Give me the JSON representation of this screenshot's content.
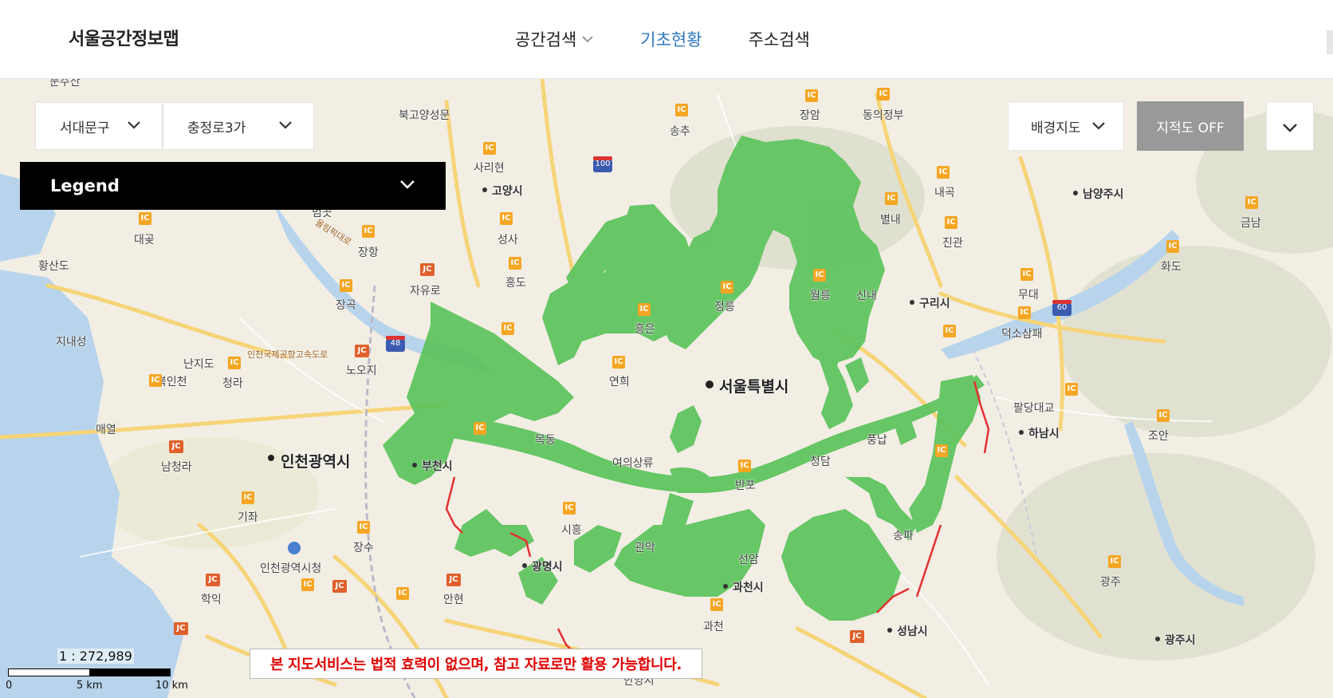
{
  "header": {
    "brand": "서울공간정보맵",
    "nav": [
      {
        "label": "공간검색",
        "has_dropdown": true,
        "active": false
      },
      {
        "label": "기초현황",
        "has_dropdown": false,
        "active": true
      },
      {
        "label": "주소검색",
        "has_dropdown": false,
        "active": false
      }
    ]
  },
  "controls": {
    "district_select": "서대문구",
    "dong_select": "충정로3가",
    "legend_label": "Legend",
    "basemap_select": "배경지도",
    "cadastral_toggle": "지적도 OFF"
  },
  "scale": {
    "ratio_label": "1 : 272,989",
    "ticks": [
      "0",
      "5 km",
      "10 km"
    ]
  },
  "notice": "본 지도서비스는 법적 효력이 없으며, 참고 자료로만 활용 가능합니다.",
  "map": {
    "overlay_color": "#5cc35c",
    "boundary_color": "#e53030",
    "major_labels": [
      "서울특별시",
      "인천광역시"
    ],
    "city_labels": [
      "고양시",
      "남양주시",
      "구리시",
      "하남시",
      "부천시",
      "광명시",
      "과천시",
      "성남시",
      "광주시"
    ],
    "place_labels": [
      "문주산",
      "북고양성문",
      "송추",
      "장암",
      "동의정부",
      "사리현",
      "내곡",
      "별내",
      "진관",
      "금남",
      "화도",
      "범곳",
      "대곶",
      "장항",
      "성사",
      "황산도",
      "흥도",
      "자유로",
      "무대",
      "덕소삼패",
      "장곡",
      "정릉",
      "월릉",
      "신내",
      "지내성",
      "난지도",
      "노오지",
      "흥은",
      "북인천",
      "청라",
      "연희",
      "팔당대교",
      "조안",
      "매열",
      "목동",
      "풍납",
      "여의상류",
      "반포",
      "청담",
      "남청라",
      "기좌",
      "시흥",
      "장수",
      "인천광역시청",
      "관악",
      "선암",
      "송파",
      "광주",
      "학익",
      "안현",
      "안양시",
      "과천"
    ],
    "route_badges": [
      "100",
      "48",
      "60"
    ],
    "road_labels": [
      "인천국제공항고속도로",
      "올림픽대로"
    ]
  }
}
